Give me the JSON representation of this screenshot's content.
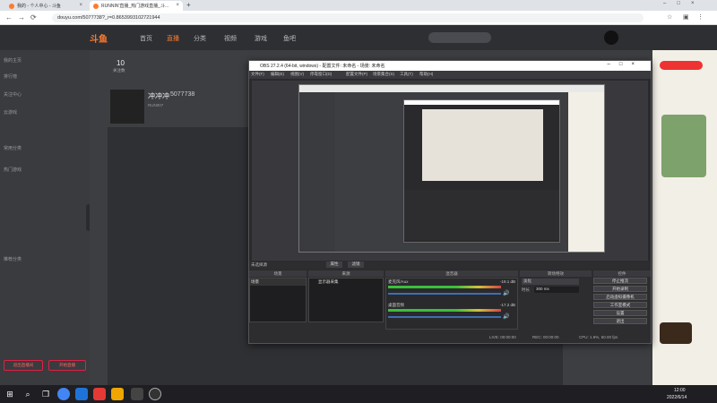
{
  "browser": {
    "tabs": [
      {
        "label": "我的 - 个人中心 - 斗鱼"
      },
      {
        "label": "RUNNIN'直播_热门游戏直播_斗..."
      }
    ],
    "url": "douyu.com/5077738?_r=0.8653993102721944"
  },
  "douyu_header": {
    "logo": "斗鱼",
    "nav": [
      "首页",
      "直播",
      "分类",
      "视频",
      "游戏",
      "鱼吧"
    ]
  },
  "sidebar": {
    "items": [
      "我的主页",
      "排行榜",
      "关注中心",
      "云游戏",
      "常用分类",
      "热门游戏",
      "推荐分类"
    ],
    "bottom_buttons": [
      "退出直播间",
      "开始直播"
    ]
  },
  "room": {
    "stats": [
      {
        "value": "10",
        "label": "关注数"
      }
    ],
    "streamer_name": "冲冲冲",
    "room_id": "5077738",
    "sub_label": "RUN007"
  },
  "obs": {
    "title": "OBS 27.2.4 (64-bit, windows) - 配置文件: 未命名 - 场景: 未命名",
    "menu": [
      "文件(F)",
      "编辑(E)",
      "视图(V)",
      "停靠窗口(D)",
      "配置文件(P)",
      "场景集合(S)",
      "工具(T)",
      "帮助(H)"
    ],
    "no_source": "未选择源",
    "props_btn": "属性",
    "filters_btn": "滤镜",
    "panels": {
      "scenes": "场景",
      "sources": "来源",
      "mixer": "混音器",
      "transitions": "转场特效",
      "controls": "控件"
    },
    "scene_items": [
      "场景"
    ],
    "source_items": [
      "显示器采集"
    ],
    "mixer_tracks": [
      {
        "name": "麦克风/Aux",
        "db": "-19.1 dB"
      },
      {
        "name": "桌面音频",
        "db": "-17.2 dB"
      }
    ],
    "transition": {
      "type": "淡化",
      "duration_label": "时长",
      "duration": "300 ms"
    },
    "controls": [
      "停止推流",
      "开始录制",
      "启动虚拟摄像机",
      "工作室模式",
      "设置",
      "退出"
    ],
    "status": {
      "live": "LIVE: 00:00:00",
      "rec": "REC: 00:00:00",
      "cpu": "CPU: 1.9%, 60.00 fps"
    }
  },
  "taskbar": {
    "time": "12:00",
    "date": "2022/6/14"
  }
}
